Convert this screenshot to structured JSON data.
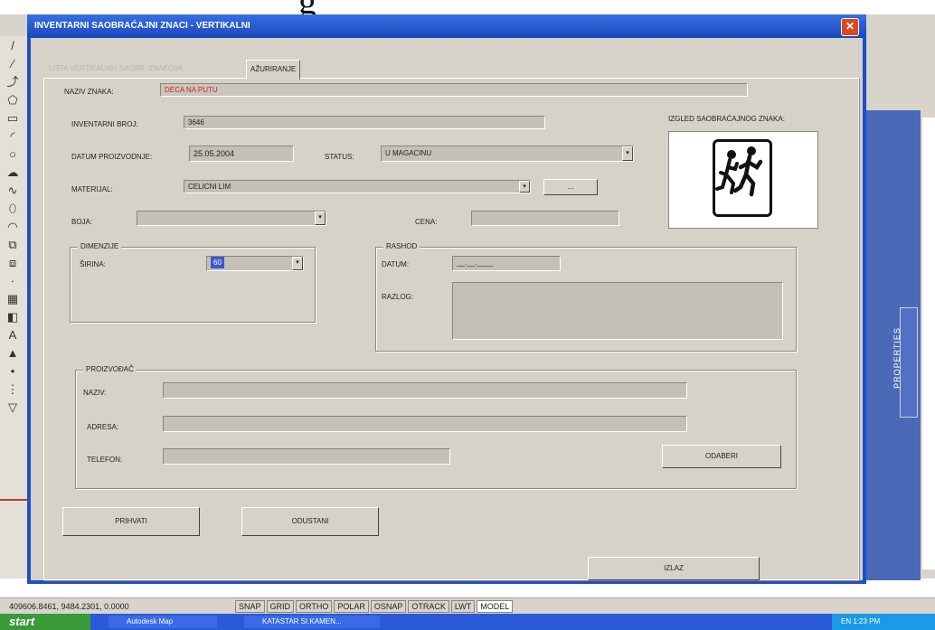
{
  "slide_title": "g",
  "dialog": {
    "title": "INVENTARNI SAOBRAĆAJNI ZNACI - VERTIKALNI",
    "close_symbol": "✕",
    "tabs": [
      {
        "label": "LISTA VERTIKALNIH SAOBR. ZNAKOVA",
        "active": false
      },
      {
        "label": "AŽURIRANJE",
        "active": true
      }
    ]
  },
  "form": {
    "naziv_znaka": {
      "label": "NAZIV ZNAKA:",
      "value": "DECA NA PUTU"
    },
    "inventarni_broj": {
      "label": "INVENTARNI BROJ:",
      "value": "3646"
    },
    "datum_proizvodnje": {
      "label": "DATUM PROIZVODNJE:",
      "value": "25.05.2004"
    },
    "status": {
      "label": "STATUS:",
      "value": "U MAGACINU"
    },
    "materijal": {
      "label": "MATERIJAL:",
      "value": "CELICNI LIM",
      "browse_label": "..."
    },
    "boja": {
      "label": "BOJA:",
      "value": ""
    },
    "cena": {
      "label": "CENA:",
      "value": ""
    },
    "izgled_label": "IZGLED SAOBRAĆAJNOG ZNAKA:",
    "dimenzije": {
      "title": "DIMENZIJE",
      "sirina_label": "ŠIRINA:",
      "sirina_value": "60"
    },
    "rashod": {
      "title": "RASHOD",
      "datum_label": "DATUM:",
      "datum_value": "__.__.____",
      "razlog_label": "RAZLOG:",
      "razlog_value": ""
    },
    "proizvodjac": {
      "title": "PROIZVOĐAČ",
      "naziv_label": "NAZIV:",
      "adresa_label": "ADRESA:",
      "telefon_label": "TELEFON:",
      "odaberi_label": "ODABERI"
    }
  },
  "buttons": {
    "prihvati": "PRIHVATI",
    "odustani": "ODUSTANI",
    "izlaz": "IZLAZ"
  },
  "background_app": {
    "coords": "409606.8461, 9484.2301, 0.0000",
    "status_toggles": [
      "SNAP",
      "GRID",
      "ORTHO",
      "POLAR",
      "OSNAP",
      "OTRACK",
      "LWT",
      "MODEL"
    ],
    "properties_label": "PROPERTIES",
    "taskbar": {
      "start": "start",
      "tasks": [
        "Autodesk Map",
        "KATASTAR SI.KAMEN..."
      ],
      "tray": "EN   1:23 PM"
    }
  },
  "colors": {
    "titlebar": "#1e4ec8",
    "dialog_bg": "#d6d2c8",
    "field_bg": "#c4c0b8",
    "naziv_text": "#d02020"
  }
}
